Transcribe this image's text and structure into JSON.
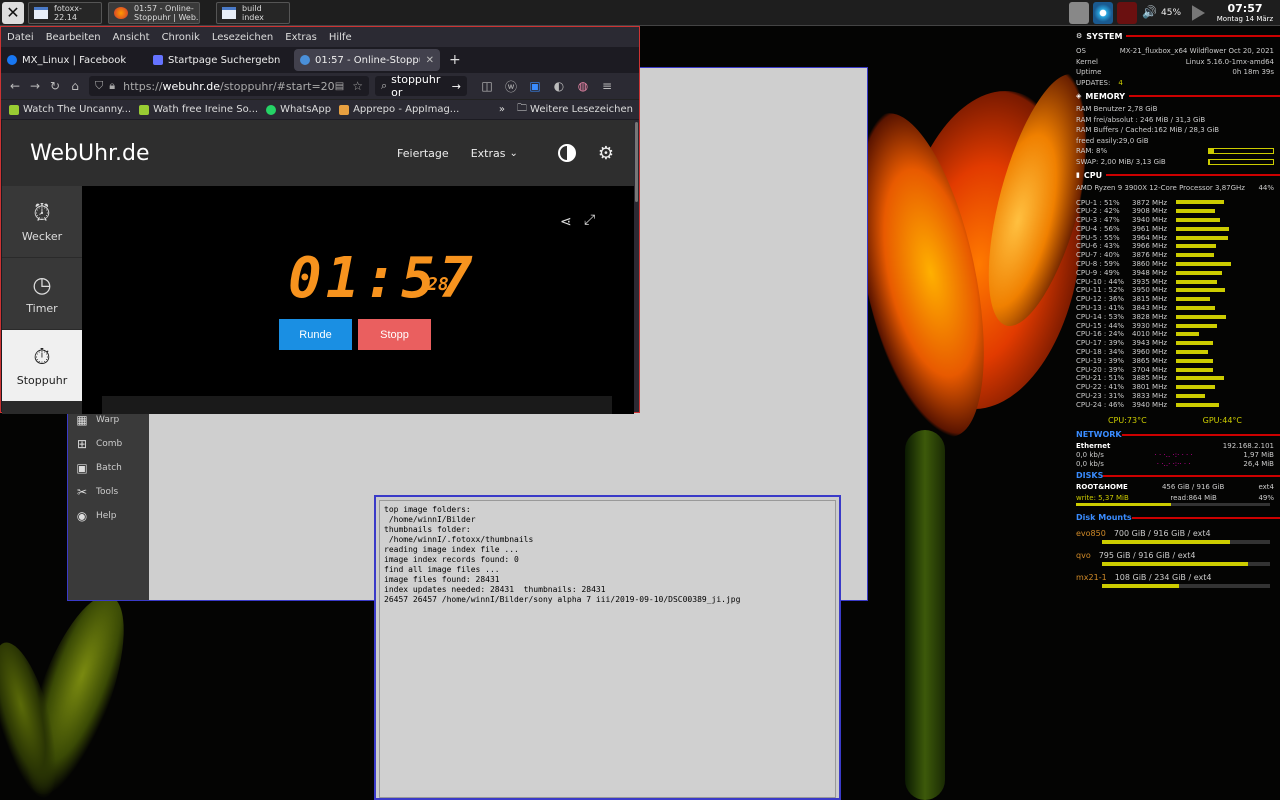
{
  "taskbar": {
    "tasks": [
      {
        "label": "fotoxx-22.14"
      },
      {
        "label": "01:57 - Online-\nStoppuhr | Web..."
      },
      {
        "label": "build index"
      }
    ],
    "volume": "45%",
    "clock_time": "07:57",
    "clock_date": "Montag 14 März"
  },
  "browser": {
    "menu": [
      "Datei",
      "Bearbeiten",
      "Ansicht",
      "Chronik",
      "Lesezeichen",
      "Extras",
      "Hilfe"
    ],
    "tabs": [
      {
        "label": "MX_Linux | Facebook",
        "color": "#1877f2"
      },
      {
        "label": "Startpage Suchergebn",
        "color": "#6573ff"
      },
      {
        "label": "01:57 - Online-Stoppul",
        "color": "#4a90d9"
      }
    ],
    "url_prefix": "https://",
    "url_host": "webuhr.de",
    "url_path": "/stoppuhr/#start=20",
    "search_value": "stoppuhr or",
    "bookmarks": [
      "Watch The Uncanny...",
      "Wath free Ireine So...",
      "WhatsApp",
      "Apprepo - AppImag..."
    ],
    "bookmarks_more": "Weitere Lesezeichen"
  },
  "site": {
    "logo": "WebUhr.de",
    "nav_holidays": "Feiertage",
    "nav_extras": "Extras",
    "side": [
      {
        "label": "Wecker"
      },
      {
        "label": "Timer"
      },
      {
        "label": "Stoppuhr"
      }
    ],
    "time_main": "01:57",
    "time_hundredths": "28",
    "btn_lap": "Runde",
    "btn_stop": "Stopp",
    "colors": {
      "lap": "#1a8fe3",
      "stop": "#ea5f5f",
      "digits": "#f7931e"
    }
  },
  "fotoxx": {
    "side_items": [
      "Warp",
      "Comb",
      "Batch",
      "Tools",
      "Help"
    ]
  },
  "dialog": {
    "lines": [
      "top image folders:",
      " /home/winnI/Bilder",
      "thumbnails folder:",
      " /home/winnI/.fotoxx/thumbnails",
      "reading image index file ...",
      "image index records found: 0",
      "find all image files ...",
      "image files found: 28431",
      "index updates needed: 28431  thumbnails: 28431",
      "26457 26457 /home/winnI/Bilder/sony alpha 7 iii/2019-09-10/DSC00389_ji.jpg"
    ]
  },
  "conky": {
    "system_title": "SYSTEM",
    "system": [
      [
        "OS",
        "MX-21_fluxbox_x64 Wildflower Oct 20, 2021"
      ],
      [
        "Kernel",
        "Linux 5.16.0-1mx-amd64"
      ],
      [
        "Uptime",
        "0h 18m 39s"
      ],
      [
        "UPDATES:",
        "4"
      ]
    ],
    "memory_title": "MEMORY",
    "memory": [
      "RAM Benutzer 2,78 GiB",
      "RAM frei/absolut : 246 MiB / 31,3 GiB",
      "RAM Buffers / Cached:162 MiB / 28,3 GiB",
      "freed easily:29,0 GiB"
    ],
    "ram_label": "RAM: 8%",
    "ram_pct": 8,
    "swap_label": "SWAP: 2,00 MiB/ 3,13 GiB",
    "swap_pct": 1,
    "cpu_title": "CPU",
    "cpu_model": "AMD Ryzen 9 3900X 12-Core Processor 3,87GHz",
    "cpu_total": "44%",
    "cpus": [
      [
        "CPU-1",
        "51%",
        "3872 MHz",
        51
      ],
      [
        "CPU-2",
        "42%",
        "3908 MHz",
        42
      ],
      [
        "CPU-3",
        "47%",
        "3940 MHz",
        47
      ],
      [
        "CPU-4",
        "56%",
        "3961 MHz",
        56
      ],
      [
        "CPU-5",
        "55%",
        "3964 MHz",
        55
      ],
      [
        "CPU-6",
        "43%",
        "3966 MHz",
        43
      ],
      [
        "CPU-7",
        "40%",
        "3876 MHz",
        40
      ],
      [
        "CPU-8",
        "59%",
        "3860 MHz",
        59
      ],
      [
        "CPU-9",
        "49%",
        "3948 MHz",
        49
      ],
      [
        "CPU-10",
        "44%",
        "3935 MHz",
        44
      ],
      [
        "CPU-11",
        "52%",
        "3950 MHz",
        52
      ],
      [
        "CPU-12",
        "36%",
        "3815 MHz",
        36
      ],
      [
        "CPU-13",
        "41%",
        "3843 MHz",
        41
      ],
      [
        "CPU-14",
        "53%",
        "3828 MHz",
        53
      ],
      [
        "CPU-15",
        "44%",
        "3930 MHz",
        44
      ],
      [
        "CPU-16",
        "24%",
        "4010 MHz",
        24
      ],
      [
        "CPU-17",
        "39%",
        "3943 MHz",
        39
      ],
      [
        "CPU-18",
        "34%",
        "3960 MHz",
        34
      ],
      [
        "CPU-19",
        "39%",
        "3865 MHz",
        39
      ],
      [
        "CPU-20",
        "39%",
        "3704 MHz",
        39
      ],
      [
        "CPU-21",
        "51%",
        "3885 MHz",
        51
      ],
      [
        "CPU-22",
        "41%",
        "3801 MHz",
        41
      ],
      [
        "CPU-23",
        "31%",
        "3833 MHz",
        31
      ],
      [
        "CPU-24",
        "46%",
        "3940 MHz",
        46
      ]
    ],
    "cpu_temp": "CPU:73°C",
    "gpu_temp": "GPU:44°C",
    "network_title": "NETWORK",
    "net_iface": "Ethernet",
    "net_ip": "192.168.2.101",
    "net_down": "0,0 kb/s",
    "net_up": "0,0 kb/s",
    "net_total_down": "1,97 MiB",
    "net_total_up": "26,4 MiB",
    "disks_title": "DISKS",
    "disk_name": "ROOT&HOME",
    "disk_size": "456 GiB / 916 GiB",
    "disk_fs": "ext4",
    "disk_write": "write: 5,37 MiB",
    "disk_read": "read:864 MiB",
    "disk_pct_label": "49%",
    "mounts_title": "Disk Mounts",
    "mounts": [
      [
        "evo850",
        "700 GiB / 916 GiB / ext4",
        76
      ],
      [
        "qvo",
        "795 GiB / 916 GiB / ext4",
        87
      ],
      [
        "mx21-1",
        "108 GiB / 234 GiB / ext4",
        46
      ]
    ]
  }
}
